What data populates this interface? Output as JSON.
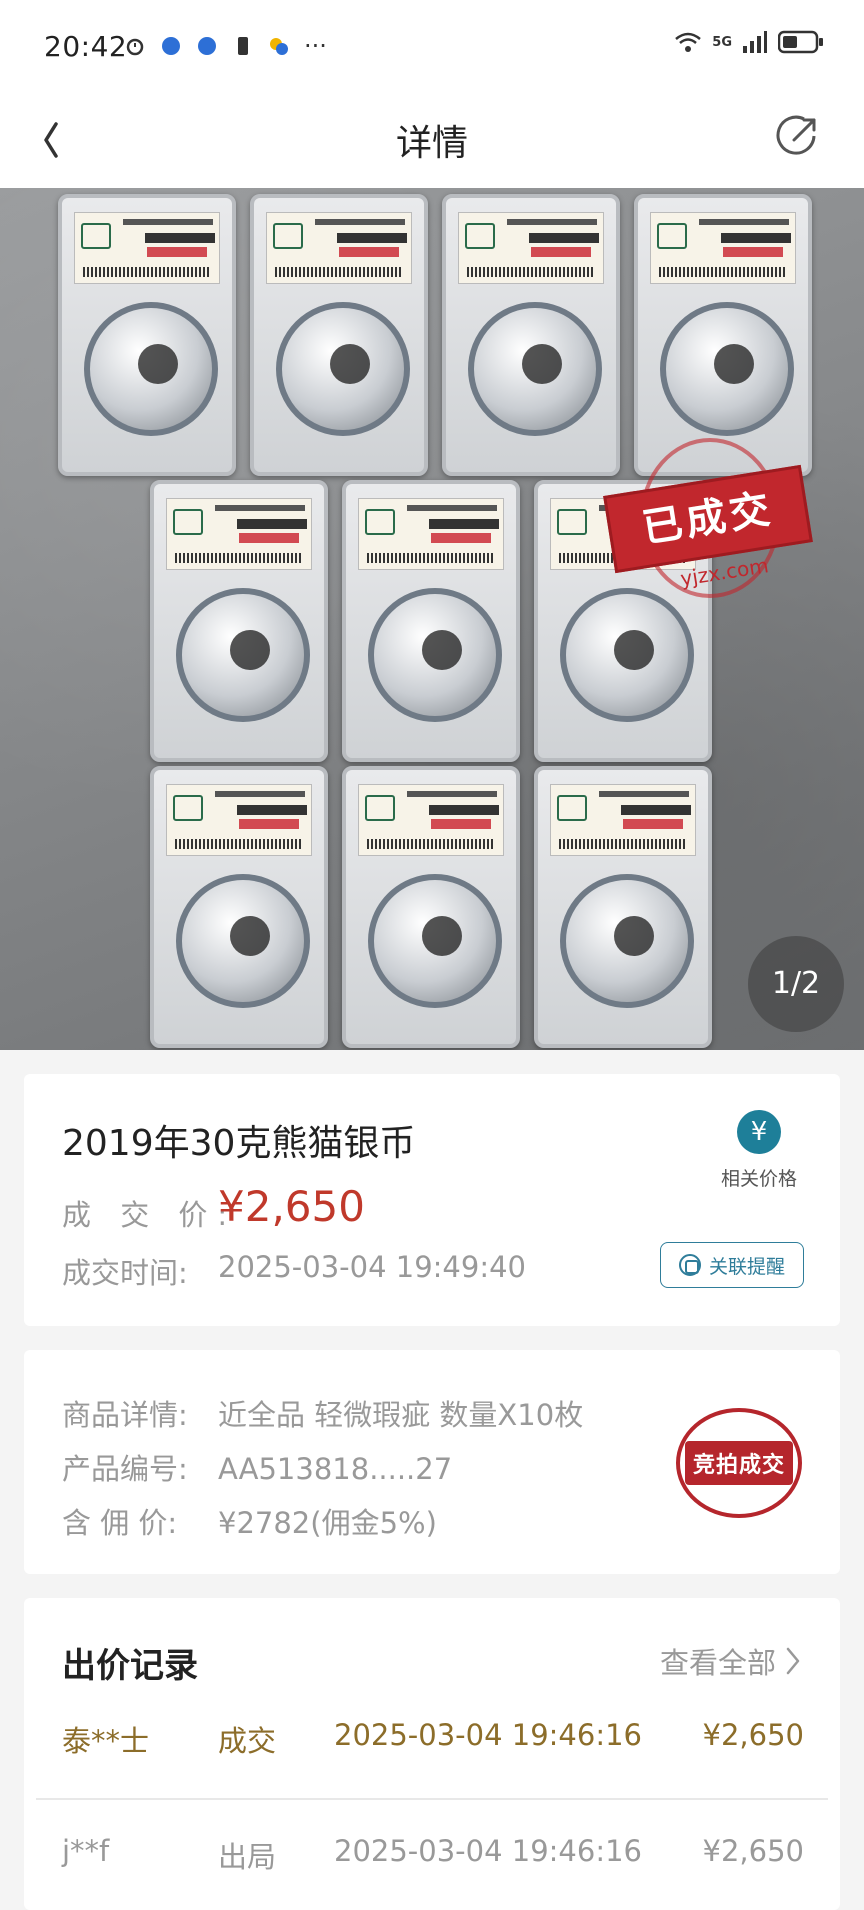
{
  "status_bar": {
    "time": "20:42",
    "network": "5G",
    "icons": [
      "alarm-icon",
      "app-icon",
      "app-icon",
      "sim-icon",
      "app-icon",
      "more-icon",
      "wifi-icon",
      "signal-icon",
      "battery-icon"
    ]
  },
  "nav": {
    "title": "详情",
    "back_icon": "chevron-left-icon",
    "share_icon": "share-icon"
  },
  "gallery": {
    "page_indicator": "1/2",
    "stamp_text": "已成交",
    "stamp_site": "yjzx.com",
    "current_page": 1,
    "total_pages": 2
  },
  "product": {
    "title": "2019年30克熊猫银币",
    "price_label": "成 交 价:",
    "price": "¥2,650",
    "time_label": "成交时间:",
    "time": "2025-03-04 19:49:40",
    "related_price_label": "相关价格",
    "related_price_icon": "¥",
    "link_remind_label": "关联提醒"
  },
  "details": {
    "rows": [
      {
        "key": "商品详情:",
        "value": "近全品 轻微瑕疵 数量X10枚"
      },
      {
        "key": "产品编号:",
        "value": "AA513818.....27"
      },
      {
        "key": "含 佣 价:",
        "value": "¥2782(佣金5%)"
      }
    ],
    "badge": "竞拍成交"
  },
  "bids": {
    "title": "出价记录",
    "view_all": "查看全部",
    "rows": [
      {
        "user": "泰**士",
        "status": "成交",
        "time": "2025-03-04 19:46:16",
        "amount": "¥2,650"
      },
      {
        "user": "j**f",
        "status": "出局",
        "time": "2025-03-04 19:46:16",
        "amount": "¥2,650"
      }
    ]
  },
  "colors": {
    "price_red": "#c0392b",
    "accent_teal": "#1e7f99",
    "winner_gold": "#8c6d2a",
    "stamp_red": "#c1272d"
  }
}
